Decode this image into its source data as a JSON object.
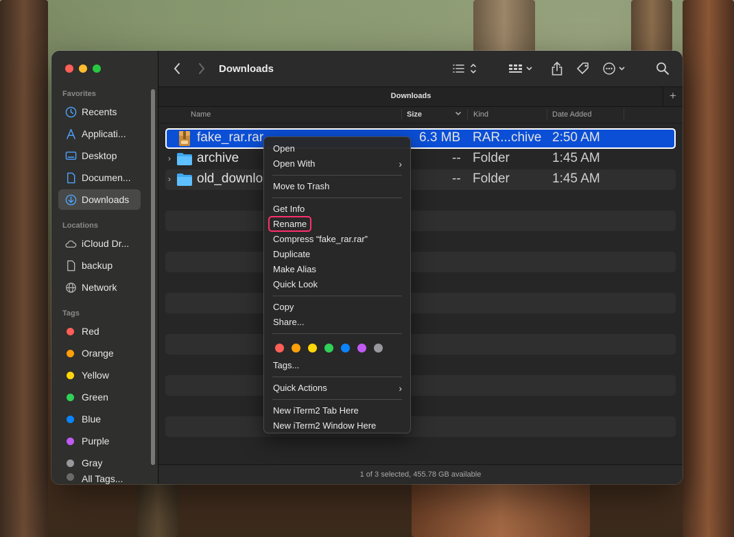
{
  "window": {
    "title": "Downloads",
    "tab_title": "Downloads",
    "status": "1 of 3 selected, 455.78 GB available"
  },
  "sidebar": {
    "favorites_header": "Favorites",
    "favorites": [
      "Recents",
      "Applicati...",
      "Desktop",
      "Documen...",
      "Downloads"
    ],
    "locations_header": "Locations",
    "locations": [
      "iCloud Dr...",
      "backup",
      "Network"
    ],
    "tags_header": "Tags",
    "tags": [
      {
        "label": "Red",
        "color": "#ff5f57"
      },
      {
        "label": "Orange",
        "color": "#ff9f0a"
      },
      {
        "label": "Yellow",
        "color": "#ffd60a"
      },
      {
        "label": "Green",
        "color": "#30d158"
      },
      {
        "label": "Blue",
        "color": "#0a84ff"
      },
      {
        "label": "Purple",
        "color": "#bf5af2"
      },
      {
        "label": "Gray",
        "color": "#98989d"
      },
      {
        "label": "All Tags..."
      }
    ]
  },
  "columns": {
    "name": "Name",
    "size": "Size",
    "kind": "Kind",
    "date": "Date Added"
  },
  "files": [
    {
      "name": "fake_rar.rar",
      "size": "6.3 MB",
      "kind": "RAR...chive",
      "date": "2:50 AM",
      "selected": true,
      "icon": "rar-archive-icon"
    },
    {
      "name": "archive",
      "size": "--",
      "kind": "Folder",
      "date": "1:45 AM",
      "icon": "folder-icon"
    },
    {
      "name": "old_downlo",
      "size": "--",
      "kind": "Folder",
      "date": "1:45 AM",
      "icon": "folder-icon"
    }
  ],
  "context_menu": {
    "open": "Open",
    "open_with": "Open With",
    "move_to_trash": "Move to Trash",
    "get_info": "Get Info",
    "rename": "Rename",
    "compress": "Compress “fake_rar.rar”",
    "duplicate": "Duplicate",
    "make_alias": "Make Alias",
    "quick_look": "Quick Look",
    "copy": "Copy",
    "share": "Share...",
    "tag_colors": [
      "#ff5f57",
      "#ff9f0a",
      "#ffd60a",
      "#30d158",
      "#0a84ff",
      "#bf5af2",
      "#98989d"
    ],
    "tags": "Tags...",
    "quick_actions": "Quick Actions",
    "iterm_tab": "New iTerm2 Tab Here",
    "iterm_window": "New iTerm2 Window Here"
  },
  "accents": {
    "selection": "#0b4fd6",
    "highlight_outline": "#ff2e6d"
  }
}
